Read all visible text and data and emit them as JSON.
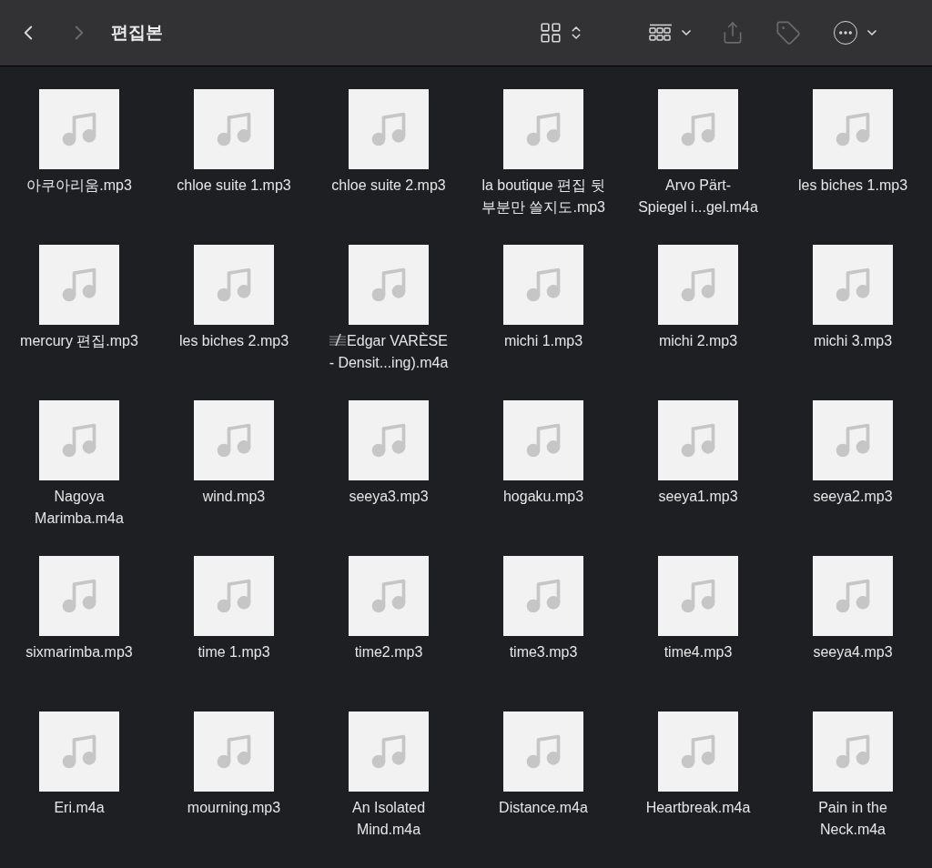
{
  "toolbar": {
    "title": "편집본",
    "back": {
      "disabled": false
    },
    "forward": {
      "disabled": true
    },
    "share": {
      "disabled": true
    },
    "tags": {
      "disabled": true
    }
  },
  "files": [
    {
      "lines": [
        "아쿠아리움.mp3"
      ]
    },
    {
      "lines": [
        "chloe suite 1.mp3"
      ]
    },
    {
      "lines": [
        "chloe suite 2.mp3"
      ]
    },
    {
      "lines": [
        "la boutique 편집 뒷",
        "부분만 쓸지도.mp3"
      ]
    },
    {
      "lines": [
        "Arvo Pärt-",
        "Spiegel i...gel.m4a"
      ]
    },
    {
      "lines": [
        "les biches 1.mp3"
      ]
    },
    {
      "lines": [
        "mercury 편집.mp3"
      ]
    },
    {
      "lines": [
        "les biches 2.mp3"
      ]
    },
    {
      "lines": [
        "Edgar VARÈSE",
        "- Densit...ing).m4a"
      ],
      "score_mark": true
    },
    {
      "lines": [
        "michi 1.mp3"
      ]
    },
    {
      "lines": [
        "michi 2.mp3"
      ]
    },
    {
      "lines": [
        "michi 3.mp3"
      ]
    },
    {
      "lines": [
        "Nagoya",
        "Marimba.m4a"
      ]
    },
    {
      "lines": [
        "wind.mp3"
      ]
    },
    {
      "lines": [
        "seeya3.mp3"
      ]
    },
    {
      "lines": [
        "hogaku.mp3"
      ]
    },
    {
      "lines": [
        "seeya1.mp3"
      ]
    },
    {
      "lines": [
        "seeya2.mp3"
      ]
    },
    {
      "lines": [
        "sixmarimba.mp3"
      ]
    },
    {
      "lines": [
        "time 1.mp3"
      ]
    },
    {
      "lines": [
        "time2.mp3"
      ]
    },
    {
      "lines": [
        "time3.mp3"
      ]
    },
    {
      "lines": [
        "time4.mp3"
      ]
    },
    {
      "lines": [
        "seeya4.mp3"
      ]
    },
    {
      "lines": [
        "Eri.m4a"
      ]
    },
    {
      "lines": [
        "mourning.mp3"
      ]
    },
    {
      "lines": [
        "An Isolated",
        "Mind.m4a"
      ]
    },
    {
      "lines": [
        "Distance.m4a"
      ]
    },
    {
      "lines": [
        "Heartbreak.m4a"
      ]
    },
    {
      "lines": [
        "Pain in the",
        "Neck.m4a"
      ]
    }
  ]
}
